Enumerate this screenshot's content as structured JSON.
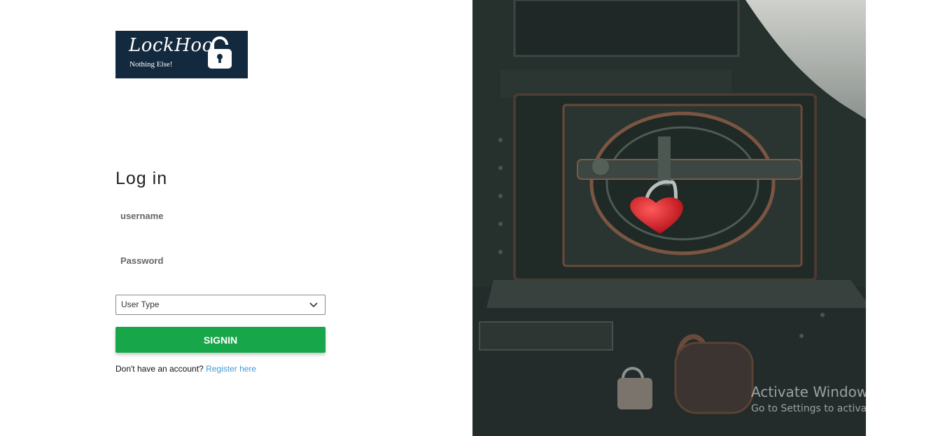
{
  "logo": {
    "brand": "LockHoo",
    "tagline": "Nothing Else!",
    "icon": "padlock-icon"
  },
  "login": {
    "title": "Log in",
    "username_placeholder": "username",
    "password_placeholder": "Password",
    "user_type": {
      "selected": "User Type",
      "icon": "chevron-down-icon"
    },
    "signin_label": "SIGNIN",
    "no_account_text": "Don't have an account?",
    "register_link": "Register here"
  },
  "colors": {
    "logo_bg": "#13293d",
    "signin_bg": "#18a64a",
    "link": "#3d9bd6"
  },
  "watermark": {
    "line1": "Activate Windows",
    "line2": "Go to Settings to activate Windows."
  }
}
